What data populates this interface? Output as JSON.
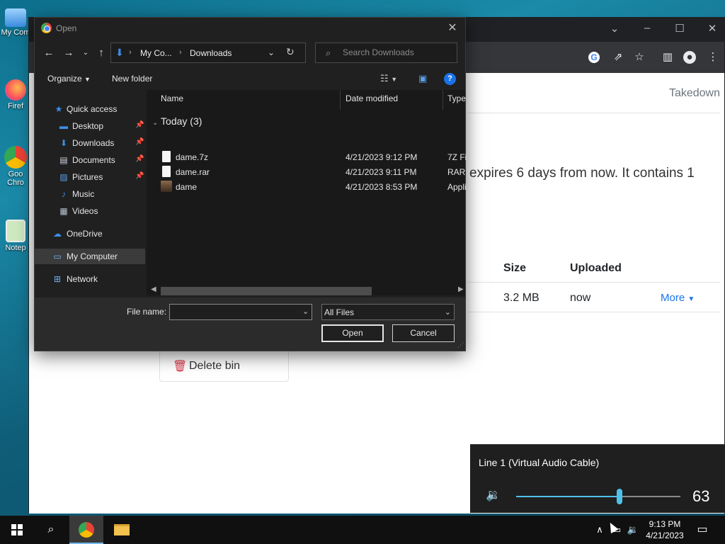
{
  "desktop": {
    "icons": [
      {
        "label": "My Com",
        "icon": "computer-icon"
      },
      {
        "label": "Firef",
        "icon": "firefox-icon"
      },
      {
        "label": "Goo Chro",
        "icon": "chrome-icon"
      },
      {
        "label": "Notep",
        "icon": "notepad-icon"
      }
    ]
  },
  "browser": {
    "page": {
      "nav_takedown": "Takedown",
      "info_text": "expires 6 days from now. It contains 1",
      "table": {
        "headers": {
          "size": "Size",
          "uploaded": "Uploaded"
        },
        "row": {
          "size": "3.2 MB",
          "uploaded": "now",
          "more": "More"
        }
      },
      "delete_label": "Delete bin"
    }
  },
  "dialog": {
    "title": "Open",
    "address": {
      "crumbs": [
        "My Co...",
        "Downloads"
      ]
    },
    "search": {
      "placeholder": "Search Downloads"
    },
    "commands": {
      "organize": "Organize",
      "new_folder": "New folder"
    },
    "nav": [
      {
        "label": "Quick access",
        "icon": "star-icon",
        "pinned": false
      },
      {
        "label": "Desktop",
        "icon": "desktop-icon",
        "pinned": true
      },
      {
        "label": "Downloads",
        "icon": "download-icon",
        "pinned": true
      },
      {
        "label": "Documents",
        "icon": "documents-icon",
        "pinned": true
      },
      {
        "label": "Pictures",
        "icon": "pictures-icon",
        "pinned": true
      },
      {
        "label": "Music",
        "icon": "music-icon",
        "pinned": false
      },
      {
        "label": "Videos",
        "icon": "videos-icon",
        "pinned": false
      },
      {
        "label": "OneDrive",
        "icon": "cloud-icon",
        "pinned": false
      },
      {
        "label": "My Computer",
        "icon": "computer-icon",
        "pinned": false
      },
      {
        "label": "Network",
        "icon": "network-icon",
        "pinned": false
      }
    ],
    "columns": {
      "name": "Name",
      "date": "Date modified",
      "type": "Type"
    },
    "group_label": "Today (3)",
    "files": [
      {
        "name": "dame.7z",
        "date": "4/21/2023 9:12 PM",
        "type": "7Z Fi"
      },
      {
        "name": "dame.rar",
        "date": "4/21/2023 9:11 PM",
        "type": "RAR"
      },
      {
        "name": "dame",
        "date": "4/21/2023 8:53 PM",
        "type": "Appli"
      }
    ],
    "file_name_label": "File name:",
    "file_name_value": "",
    "file_type": "All Files",
    "open_label": "Open",
    "cancel_label": "Cancel"
  },
  "volume": {
    "device": "Line 1 (Virtual Audio Cable)",
    "value": "63",
    "level_percent": 63,
    "accent": "#4fc1e9"
  },
  "taskbar": {
    "time": "9:13 PM",
    "date": "4/21/2023"
  }
}
